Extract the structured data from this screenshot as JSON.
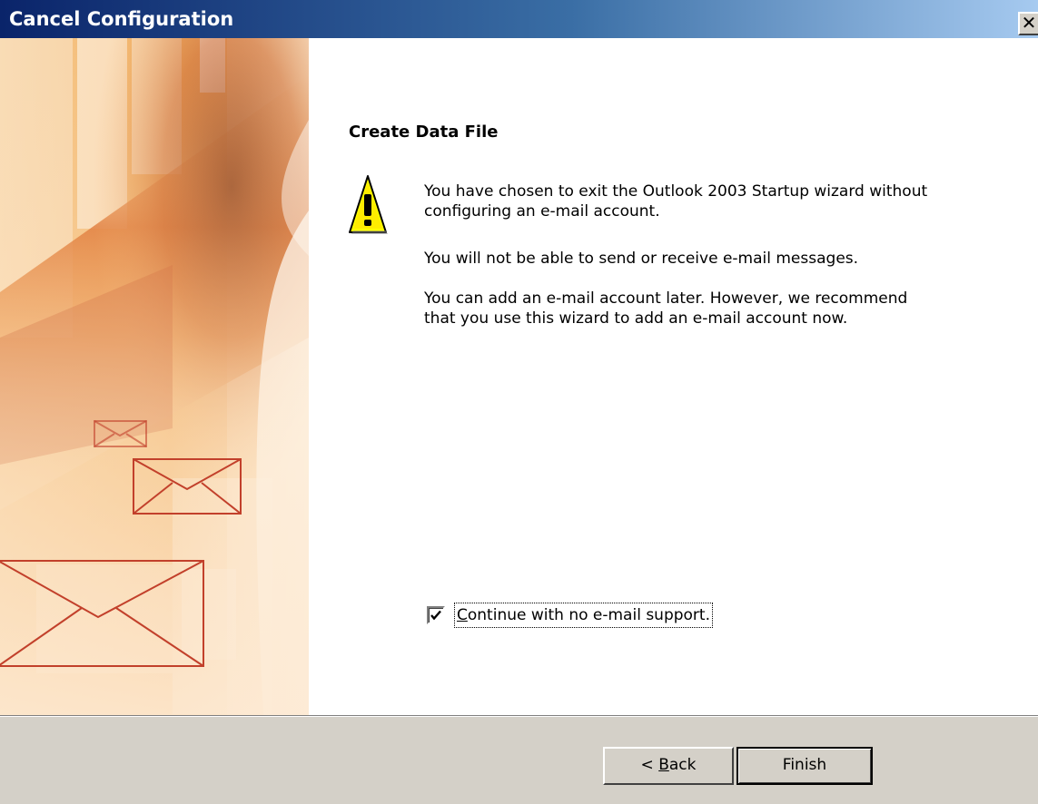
{
  "window": {
    "title": "Cancel Configuration",
    "close_glyph": "✕"
  },
  "page": {
    "heading": "Create Data File",
    "icon": "warning-icon",
    "message1": "You have chosen to exit the Outlook 2003 Startup wizard without configuring an e-mail account.",
    "message2": "You will not be able to send or receive e-mail messages.",
    "message3": "You can add an e-mail account later. However, we recommend that you use this wizard to add an e-mail account now."
  },
  "checkbox": {
    "label_first": "C",
    "label_rest": "ontinue with no e-mail support.",
    "checked": true
  },
  "buttons": {
    "back_prefix": "< ",
    "back_accel": "B",
    "back_rest": "ack",
    "finish": "Finish"
  },
  "colors": {
    "titlebar_start": "#0a246a",
    "titlebar_end": "#a6caf0",
    "face": "#d4d0c8",
    "art_orange": "#d96a1e"
  }
}
